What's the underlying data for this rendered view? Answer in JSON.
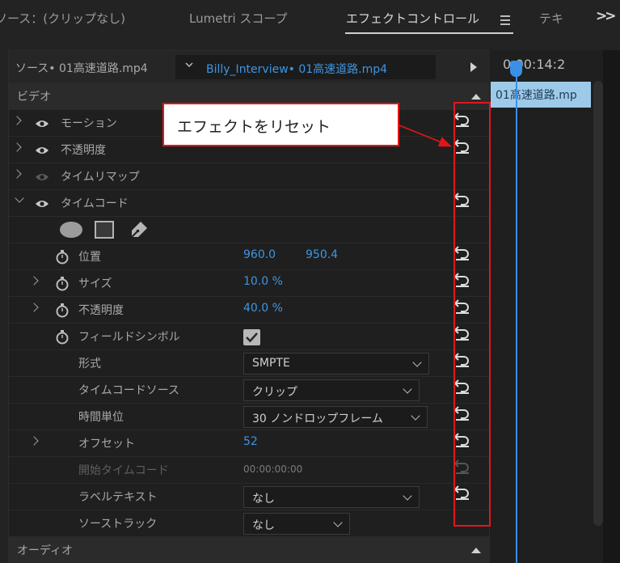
{
  "tabs": [
    {
      "label": "ソース：(クリップなし)"
    },
    {
      "label": "Lumetri スコープ"
    },
    {
      "label": "エフェクトコントロール"
    },
    {
      "label": "テキ"
    }
  ],
  "source": {
    "label": "ソース• 01高速道路.mp4",
    "clip": "Billy_Interview• 01高速道路.mp4"
  },
  "sections": {
    "video": "ビデオ",
    "audio": "オーディオ"
  },
  "effects": [
    {
      "label": "モーション"
    },
    {
      "label": "不透明度"
    },
    {
      "label": "タイムリマップ"
    },
    {
      "label": "タイムコード"
    }
  ],
  "properties": {
    "position": {
      "label": "位置",
      "x": "960.0",
      "y": "950.4"
    },
    "size": {
      "label": "サイズ",
      "value": "10.0 %"
    },
    "opacity": {
      "label": "不透明度",
      "value": "40.0 %"
    },
    "field_symbol": {
      "label": "フィールドシンボル",
      "checked": true
    },
    "format": {
      "label": "形式",
      "value": "SMPTE"
    },
    "tc_source": {
      "label": "タイムコードソース",
      "value": "クリップ"
    },
    "time_unit": {
      "label": "時間単位",
      "value": "30 ノンドロップフレーム"
    },
    "offset": {
      "label": "オフセット",
      "value": "52"
    },
    "start_tc": {
      "label": "開始タイムコード",
      "value": "00:00:00:00"
    },
    "label_text": {
      "label": "ラベルテキスト",
      "value": "なし"
    },
    "source_track": {
      "label": "ソーストラック",
      "value": "なし"
    }
  },
  "annotation": {
    "text": "エフェクトをリセット",
    "color": "#e3151a"
  },
  "timeline": {
    "timecode": "0:00:14:2",
    "clip": "01高速道路.mp",
    "accent": "#3a90e6",
    "clip_color": "#9ecae9"
  },
  "colors": {
    "value_blue": "#3d96e3",
    "panel_bg": "#1f1f1f"
  }
}
